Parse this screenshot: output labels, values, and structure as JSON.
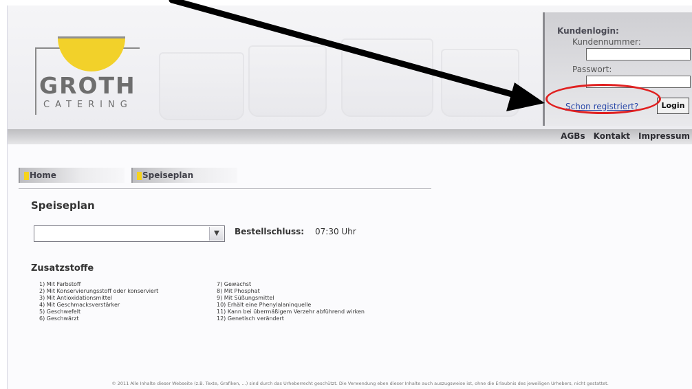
{
  "header": {
    "logo": {
      "name": "GROTH",
      "sub": "CATERING"
    }
  },
  "login": {
    "title": "Kundenlogin:",
    "customer_number_label": "Kundennummer:",
    "customer_number_value": "",
    "password_label": "Passwort:",
    "password_value": "",
    "register_link": "Schon registriert?",
    "login_button": "Login"
  },
  "top_nav": {
    "links": [
      "AGBs",
      "Kontakt",
      "Impressum"
    ]
  },
  "tabs": [
    {
      "label": "Home"
    },
    {
      "label": "Speiseplan"
    }
  ],
  "speiseplan": {
    "title": "Speiseplan",
    "select_value": "",
    "deadline_label": "Bestellschluss:",
    "deadline_value": "07:30 Uhr"
  },
  "zusatzstoffe": {
    "title": "Zusatzstoffe",
    "left": [
      "1) Mit Farbstoff",
      "2) Mit Konservierungsstoff oder konserviert",
      "3) Mit Antioxidationsmittel",
      "4) Mit Geschmacksverstärker",
      "5) Geschwefelt",
      "6) Geschwärzt"
    ],
    "right": [
      "7) Gewachst",
      "8) Mit Phosphat",
      "9) Mit Süßungsmittel",
      "10) Erhält eine Phenylalaninquelle",
      "11) Kann bei übermäßigem Verzehr abführend wirken",
      "12) Genetisch verändert"
    ]
  },
  "footer": {
    "text": "© 2011 Alle Inhalte dieser Webseite (z.B. Texte, Grafiken, ...) sind durch das Urheberrecht geschützt. Die Verwendung eben dieser Inhalte auch auszugsweise ist, ohne die Erlaubnis des jeweiligen Urhebers, nicht gestattet."
  },
  "colors": {
    "accent_yellow": "#f6d31c",
    "highlight_red": "#e02020",
    "link_blue": "#2b49a8"
  }
}
